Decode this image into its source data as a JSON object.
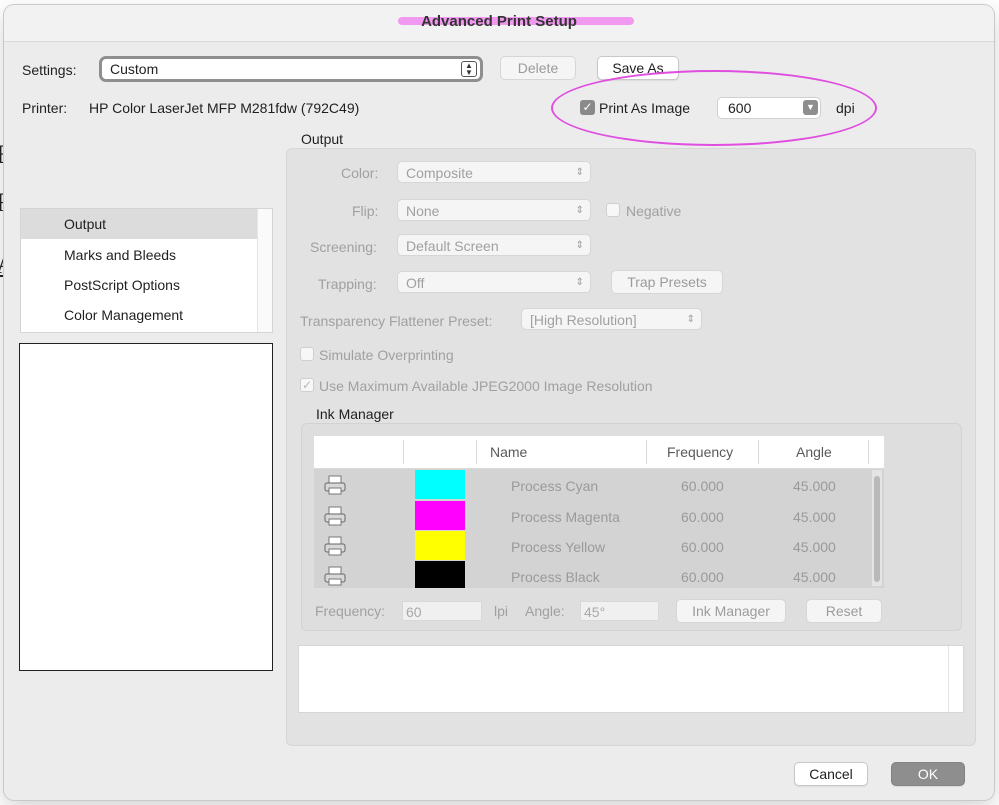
{
  "dialog": {
    "title": "Advanced Print Setup"
  },
  "settings": {
    "label": "Settings:",
    "value": "Custom",
    "delete_label": "Delete",
    "save_as_label": "Save As"
  },
  "printer": {
    "label": "Printer:",
    "name": "HP Color LaserJet MFP M281fdw (792C49)",
    "print_as_image_label": "Print As Image",
    "print_as_image_checked": true,
    "dpi_value": "600",
    "dpi_unit": "dpi"
  },
  "sidebar": {
    "items": [
      {
        "label": "Output",
        "selected": true
      },
      {
        "label": "Marks and Bleeds",
        "selected": false
      },
      {
        "label": "PostScript Options",
        "selected": false
      },
      {
        "label": "Color Management",
        "selected": false
      }
    ]
  },
  "output": {
    "heading": "Output",
    "color_label": "Color:",
    "color_value": "Composite",
    "flip_label": "Flip:",
    "flip_value": "None",
    "negative_label": "Negative",
    "screening_label": "Screening:",
    "screening_value": "Default Screen",
    "trapping_label": "Trapping:",
    "trapping_value": "Off",
    "trap_presets_label": "Trap Presets",
    "flattener_label": "Transparency Flattener Preset:",
    "flattener_value": "[High Resolution]",
    "simulate_overprinting_label": "Simulate Overprinting",
    "use_max_jpeg_label": "Use Maximum Available JPEG2000 Image Resolution"
  },
  "ink_manager": {
    "heading": "Ink Manager",
    "columns": [
      "Name",
      "Frequency",
      "Angle"
    ],
    "rows": [
      {
        "name": "Process Cyan",
        "frequency": "60.000",
        "angle": "45.000",
        "swatch": "#00ffff"
      },
      {
        "name": "Process Magenta",
        "frequency": "60.000",
        "angle": "45.000",
        "swatch": "#ff00ff"
      },
      {
        "name": "Process Yellow",
        "frequency": "60.000",
        "angle": "45.000",
        "swatch": "#ffff00"
      },
      {
        "name": "Process Black",
        "frequency": "60.000",
        "angle": "45.000",
        "swatch": "#000000"
      }
    ],
    "frequency_label": "Frequency:",
    "frequency_value": "60",
    "frequency_unit": "lpi",
    "angle_label": "Angle:",
    "angle_value": "45°",
    "ink_manager_button": "Ink Manager",
    "reset_button": "Reset"
  },
  "footer": {
    "cancel_label": "Cancel",
    "ok_label": "OK"
  },
  "annotation_colors": {
    "highlight": "#f07bf0",
    "ellipse": "#e04ee0"
  }
}
